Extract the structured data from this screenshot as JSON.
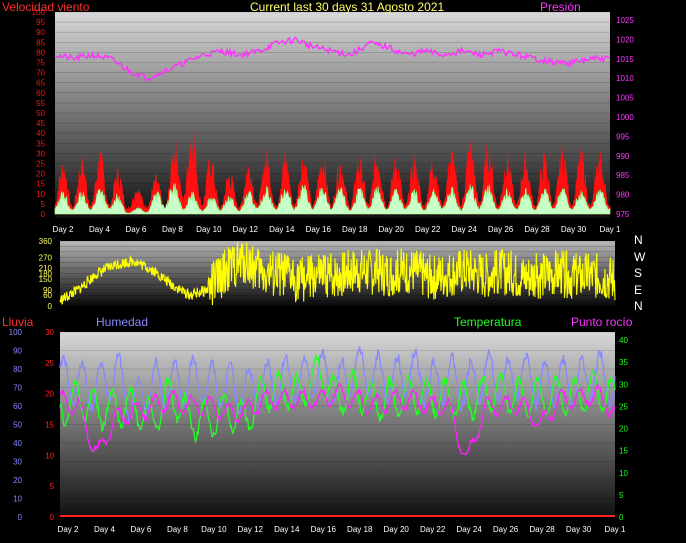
{
  "header": {
    "title": "Current last 30 days 31 Agosto 2021",
    "wind_label": "Velocidad viento",
    "pressure_label": "Presión",
    "rain_label": "Lluvia",
    "humidity_label": "Humedad",
    "temp_label": "Temperatura",
    "dew_label": "Punto rocío"
  },
  "compass": [
    "N",
    "W",
    "S",
    "E",
    "N"
  ],
  "colors": {
    "wind_gust": "#ff1010",
    "wind_avg": "#c8ffc8",
    "pressure": "#ff33ff",
    "direction": "#ffff00",
    "humidity": "#8888ff",
    "temperature": "#22ff22",
    "dew": "#ff22ff",
    "rain": "#ff2222"
  },
  "x_labels": [
    "Day 2",
    "Day 4",
    "Day 6",
    "Day 8",
    "Day 10",
    "Day 12",
    "Day 14",
    "Day 16",
    "Day 18",
    "Day 20",
    "Day 22",
    "Day 24",
    "Day 26",
    "Day 28",
    "Day 30",
    "Day 1"
  ],
  "chart_data": [
    {
      "type": "area",
      "name": "wind",
      "x": [
        1,
        2,
        3,
        4,
        5,
        6,
        7,
        8,
        9,
        10,
        11,
        12,
        13,
        14,
        15,
        16,
        17,
        18,
        19,
        20,
        21,
        22,
        23,
        24,
        25,
        26,
        27,
        28,
        29,
        30,
        31
      ],
      "series": [
        {
          "name": "Velocidad viento",
          "values": [
            25,
            22,
            28,
            26,
            12,
            14,
            20,
            50,
            30,
            20,
            18,
            30,
            25,
            28,
            26,
            27,
            22,
            30,
            25,
            26,
            24,
            28,
            30,
            35,
            25,
            28,
            24,
            30,
            28,
            26,
            30
          ]
        },
        {
          "name": "avg",
          "values": [
            12,
            10,
            12,
            14,
            2,
            5,
            18,
            12,
            8,
            10,
            8,
            14,
            12,
            15,
            13,
            14,
            10,
            15,
            12,
            13,
            10,
            14,
            12,
            16,
            11,
            13,
            11,
            14,
            12,
            12,
            14
          ]
        }
      ],
      "ylim": [
        0,
        100
      ],
      "yticks": [
        0,
        5,
        10,
        15,
        20,
        25,
        30,
        35,
        40,
        45,
        50,
        55,
        60,
        65,
        70,
        75,
        80,
        85,
        90,
        95,
        100
      ]
    },
    {
      "type": "line",
      "name": "pressure",
      "x": [
        1,
        2,
        3,
        4,
        5,
        6,
        7,
        8,
        9,
        10,
        11,
        12,
        13,
        14,
        15,
        16,
        17,
        18,
        19,
        20,
        21,
        22,
        23,
        24,
        25,
        26,
        27,
        28,
        29,
        30,
        31
      ],
      "series": [
        {
          "name": "Presión",
          "values": [
            1016,
            1015,
            1016,
            1015,
            1012,
            1010,
            1012,
            1014,
            1016,
            1017,
            1016,
            1017,
            1019,
            1020,
            1018,
            1017,
            1016,
            1019,
            1018,
            1016,
            1017,
            1016,
            1017,
            1016,
            1017,
            1016,
            1015,
            1014,
            1014,
            1015,
            1015
          ]
        }
      ],
      "ylim": [
        975,
        1025
      ],
      "yticks": [
        975,
        980,
        985,
        990,
        995,
        1000,
        1005,
        1010,
        1015,
        1020,
        1025
      ]
    },
    {
      "type": "line",
      "name": "direction",
      "x": [
        1,
        2,
        3,
        4,
        5,
        6,
        7,
        8,
        9,
        10,
        11,
        12,
        13,
        14,
        15,
        16,
        17,
        18,
        19,
        20,
        21,
        22,
        23,
        24,
        25,
        26,
        27,
        28,
        29,
        30,
        31
      ],
      "series": [
        {
          "name": "direction",
          "values": [
            30,
            90,
            180,
            230,
            250,
            200,
            120,
            60,
            90,
            200,
            250,
            180,
            170,
            150,
            160,
            170,
            200,
            190,
            180,
            200,
            160,
            180,
            200,
            170,
            190,
            160,
            170,
            180,
            160,
            170,
            150
          ]
        }
      ],
      "ylim": [
        0,
        360
      ],
      "yticks": [
        0,
        30,
        60,
        90,
        120,
        150,
        180,
        210,
        240,
        270,
        300,
        330,
        360
      ],
      "ytick_labels": [
        "0",
        "",
        "60",
        "90",
        "",
        "150",
        "180",
        "210",
        "",
        "270",
        "",
        "",
        "360"
      ]
    },
    {
      "type": "line",
      "name": "humidity-temp",
      "x": [
        1,
        2,
        3,
        4,
        5,
        6,
        7,
        8,
        9,
        10,
        11,
        12,
        13,
        14,
        15,
        16,
        17,
        18,
        19,
        20,
        21,
        22,
        23,
        24,
        25,
        26,
        27,
        28,
        29,
        30,
        31
      ],
      "series": [
        {
          "name": "Humedad",
          "values": [
            75,
            72,
            70,
            78,
            60,
            72,
            70,
            74,
            72,
            70,
            68,
            72,
            75,
            74,
            78,
            70,
            80,
            76,
            74,
            78,
            72,
            76,
            70,
            78,
            72,
            78,
            70,
            74,
            72,
            78,
            70
          ]
        },
        {
          "name": "Temperatura",
          "values": [
            24,
            27,
            24,
            25,
            25,
            22,
            28,
            22,
            22,
            24,
            22,
            28,
            29,
            28,
            33,
            27,
            29,
            26,
            27,
            28,
            27,
            27,
            26,
            28,
            28,
            27,
            27,
            28,
            27,
            29,
            27
          ]
        },
        {
          "name": "Punto rocío",
          "values": [
            19,
            18,
            10,
            16,
            17,
            18,
            19,
            18,
            18,
            17,
            17,
            19,
            19,
            19,
            19,
            20,
            19,
            18,
            19,
            19,
            18,
            18,
            9,
            18,
            18,
            18,
            15,
            19,
            19,
            20,
            17
          ]
        },
        {
          "name": "Lluvia",
          "values": [
            0,
            0,
            0,
            0,
            0,
            0,
            0,
            0,
            0,
            0,
            0,
            0,
            0,
            0,
            0,
            0,
            0,
            0,
            0,
            0,
            0,
            0,
            0,
            0,
            0,
            0,
            0,
            0,
            0,
            0,
            0
          ]
        }
      ],
      "ylim_rain": [
        0,
        30
      ],
      "ylim_humidity": [
        0,
        100
      ],
      "ylim_temperature": [
        0,
        40
      ],
      "yticks_rain": [
        0,
        5,
        10,
        15,
        20,
        25,
        30
      ],
      "yticks_humidity": [
        0,
        10,
        20,
        30,
        40,
        50,
        60,
        70,
        80,
        90,
        100
      ],
      "yticks_temperature": [
        0,
        5,
        10,
        15,
        20,
        25,
        30,
        35,
        40
      ]
    }
  ]
}
